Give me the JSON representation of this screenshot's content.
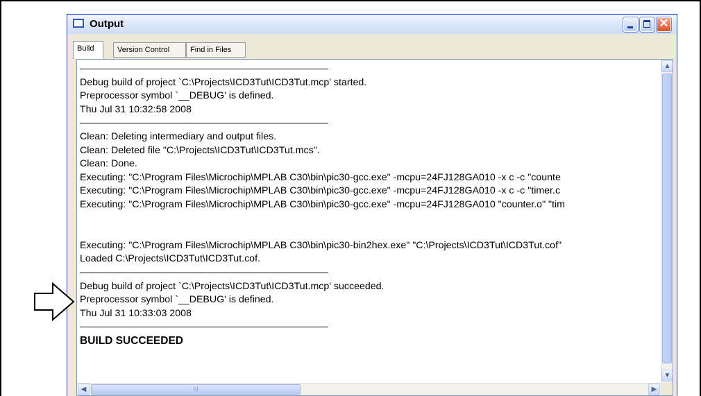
{
  "window": {
    "title": "Output",
    "icon": "window-icon",
    "controls": [
      "minimize",
      "maximize",
      "close"
    ]
  },
  "tabs": [
    {
      "label": "Build",
      "active": true
    },
    {
      "label": "Version Control",
      "active": false
    },
    {
      "label": "Find in Files",
      "active": false
    }
  ],
  "log": [
    {
      "type": "separator"
    },
    {
      "type": "text",
      "text": "Debug build of project `C:\\Projects\\ICD3Tut\\ICD3Tut.mcp' started."
    },
    {
      "type": "text",
      "text": "Preprocessor symbol `__DEBUG' is defined."
    },
    {
      "type": "text",
      "text": "Thu Jul 31 10:32:58 2008"
    },
    {
      "type": "separator"
    },
    {
      "type": "text",
      "text": "Clean: Deleting intermediary and output files."
    },
    {
      "type": "text",
      "text": "Clean: Deleted file \"C:\\Projects\\ICD3Tut\\ICD3Tut.mcs\"."
    },
    {
      "type": "text",
      "text": "Clean: Done."
    },
    {
      "type": "text",
      "text": "Executing: \"C:\\Program Files\\Microchip\\MPLAB C30\\bin\\pic30-gcc.exe\" -mcpu=24FJ128GA010 -x c -c   \"counte"
    },
    {
      "type": "text",
      "text": "Executing: \"C:\\Program Files\\Microchip\\MPLAB C30\\bin\\pic30-gcc.exe\" -mcpu=24FJ128GA010 -x c -c   \"timer.c"
    },
    {
      "type": "text",
      "text": "Executing: \"C:\\Program Files\\Microchip\\MPLAB C30\\bin\\pic30-gcc.exe\" -mcpu=24FJ128GA010 \"counter.o\" \"tim"
    },
    {
      "type": "blank"
    },
    {
      "type": "blank"
    },
    {
      "type": "text",
      "text": "Executing: \"C:\\Program Files\\Microchip\\MPLAB C30\\bin\\pic30-bin2hex.exe\" \"C:\\Projects\\ICD3Tut\\ICD3Tut.cof\""
    },
    {
      "type": "text",
      "text": "Loaded C:\\Projects\\ICD3Tut\\ICD3Tut.cof."
    },
    {
      "type": "separator"
    },
    {
      "type": "text",
      "text": "Debug build of project `C:\\Projects\\ICD3Tut\\ICD3Tut.mcp' succeeded."
    },
    {
      "type": "text",
      "text": "Preprocessor symbol `__DEBUG' is defined."
    },
    {
      "type": "text",
      "text": "Thu Jul 31 10:33:03 2008"
    },
    {
      "type": "separator"
    },
    {
      "type": "bold",
      "text": "BUILD SUCCEEDED"
    }
  ],
  "scrollbar": {
    "hthumb_label": "III"
  }
}
